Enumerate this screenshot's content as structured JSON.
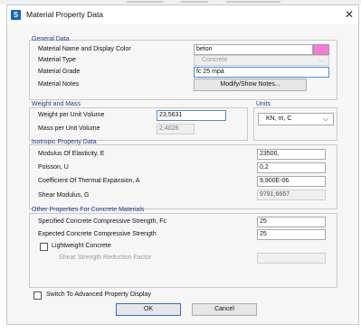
{
  "window": {
    "title": "Material Property Data",
    "app_icon": "S"
  },
  "general": {
    "legend": "General Data",
    "name_label": "Material Name and Display Color",
    "name_value": "beton",
    "display_color": "#f77ad8",
    "type_label": "Material Type",
    "type_value": "Concrete",
    "grade_label": "Material Grade",
    "grade_value": "fc 25 mpa",
    "notes_label": "Material Notes",
    "notes_button": "Modify/Show Notes..."
  },
  "weight": {
    "legend": "Weight and Mass",
    "weight_label": "Weight per Unit Volume",
    "weight_value": "23,5631",
    "mass_label": "Mass per Unit Volume",
    "mass_value": "2,4028"
  },
  "units": {
    "legend": "Units",
    "value": "KN, m, C"
  },
  "isotropic": {
    "legend": "Isotropic Property Data",
    "rows": [
      {
        "label": "Modulus Of Elasticity,  E",
        "value": "23500,"
      },
      {
        "label": "Poisson,  U",
        "value": "0,2"
      },
      {
        "label": "Coefficient Of Thermal Expansion,  A",
        "value": "9,900E-06"
      },
      {
        "label": "Shear Modulus,  G",
        "value": "9791,6667"
      }
    ]
  },
  "concrete": {
    "legend": "Other Properties For Concrete Materials",
    "fc_label": "Specified Concrete Compressive Strength, Fc",
    "fc_value": "25",
    "expected_label": "Expected Concrete Compressive Strength",
    "expected_value": "25",
    "lightweight_label": "Lightweight Concrete",
    "shear_reduction_label": "Shear Strength Reduction Factor",
    "shear_reduction_value": ""
  },
  "footer": {
    "advanced_label": "Switch To Advanced Property Display",
    "ok_label": "OK",
    "cancel_label": "Cancel"
  }
}
